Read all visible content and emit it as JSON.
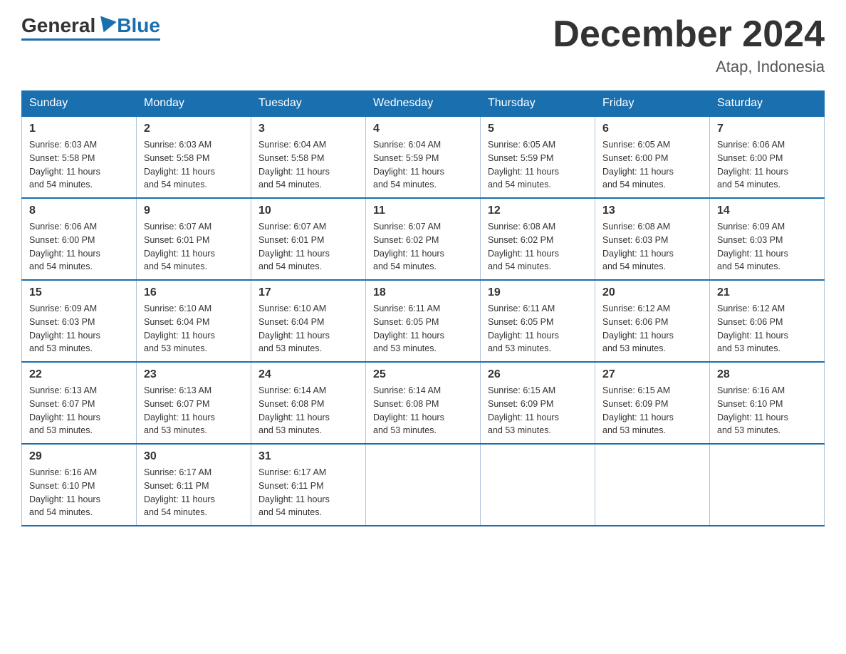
{
  "header": {
    "logo": {
      "text_general": "General",
      "text_blue": "Blue"
    },
    "title": "December 2024",
    "location": "Atap, Indonesia"
  },
  "calendar": {
    "days_of_week": [
      "Sunday",
      "Monday",
      "Tuesday",
      "Wednesday",
      "Thursday",
      "Friday",
      "Saturday"
    ],
    "weeks": [
      [
        {
          "day": "1",
          "sunrise": "6:03 AM",
          "sunset": "5:58 PM",
          "daylight": "11 hours and 54 minutes."
        },
        {
          "day": "2",
          "sunrise": "6:03 AM",
          "sunset": "5:58 PM",
          "daylight": "11 hours and 54 minutes."
        },
        {
          "day": "3",
          "sunrise": "6:04 AM",
          "sunset": "5:58 PM",
          "daylight": "11 hours and 54 minutes."
        },
        {
          "day": "4",
          "sunrise": "6:04 AM",
          "sunset": "5:59 PM",
          "daylight": "11 hours and 54 minutes."
        },
        {
          "day": "5",
          "sunrise": "6:05 AM",
          "sunset": "5:59 PM",
          "daylight": "11 hours and 54 minutes."
        },
        {
          "day": "6",
          "sunrise": "6:05 AM",
          "sunset": "6:00 PM",
          "daylight": "11 hours and 54 minutes."
        },
        {
          "day": "7",
          "sunrise": "6:06 AM",
          "sunset": "6:00 PM",
          "daylight": "11 hours and 54 minutes."
        }
      ],
      [
        {
          "day": "8",
          "sunrise": "6:06 AM",
          "sunset": "6:00 PM",
          "daylight": "11 hours and 54 minutes."
        },
        {
          "day": "9",
          "sunrise": "6:07 AM",
          "sunset": "6:01 PM",
          "daylight": "11 hours and 54 minutes."
        },
        {
          "day": "10",
          "sunrise": "6:07 AM",
          "sunset": "6:01 PM",
          "daylight": "11 hours and 54 minutes."
        },
        {
          "day": "11",
          "sunrise": "6:07 AM",
          "sunset": "6:02 PM",
          "daylight": "11 hours and 54 minutes."
        },
        {
          "day": "12",
          "sunrise": "6:08 AM",
          "sunset": "6:02 PM",
          "daylight": "11 hours and 54 minutes."
        },
        {
          "day": "13",
          "sunrise": "6:08 AM",
          "sunset": "6:03 PM",
          "daylight": "11 hours and 54 minutes."
        },
        {
          "day": "14",
          "sunrise": "6:09 AM",
          "sunset": "6:03 PM",
          "daylight": "11 hours and 54 minutes."
        }
      ],
      [
        {
          "day": "15",
          "sunrise": "6:09 AM",
          "sunset": "6:03 PM",
          "daylight": "11 hours and 53 minutes."
        },
        {
          "day": "16",
          "sunrise": "6:10 AM",
          "sunset": "6:04 PM",
          "daylight": "11 hours and 53 minutes."
        },
        {
          "day": "17",
          "sunrise": "6:10 AM",
          "sunset": "6:04 PM",
          "daylight": "11 hours and 53 minutes."
        },
        {
          "day": "18",
          "sunrise": "6:11 AM",
          "sunset": "6:05 PM",
          "daylight": "11 hours and 53 minutes."
        },
        {
          "day": "19",
          "sunrise": "6:11 AM",
          "sunset": "6:05 PM",
          "daylight": "11 hours and 53 minutes."
        },
        {
          "day": "20",
          "sunrise": "6:12 AM",
          "sunset": "6:06 PM",
          "daylight": "11 hours and 53 minutes."
        },
        {
          "day": "21",
          "sunrise": "6:12 AM",
          "sunset": "6:06 PM",
          "daylight": "11 hours and 53 minutes."
        }
      ],
      [
        {
          "day": "22",
          "sunrise": "6:13 AM",
          "sunset": "6:07 PM",
          "daylight": "11 hours and 53 minutes."
        },
        {
          "day": "23",
          "sunrise": "6:13 AM",
          "sunset": "6:07 PM",
          "daylight": "11 hours and 53 minutes."
        },
        {
          "day": "24",
          "sunrise": "6:14 AM",
          "sunset": "6:08 PM",
          "daylight": "11 hours and 53 minutes."
        },
        {
          "day": "25",
          "sunrise": "6:14 AM",
          "sunset": "6:08 PM",
          "daylight": "11 hours and 53 minutes."
        },
        {
          "day": "26",
          "sunrise": "6:15 AM",
          "sunset": "6:09 PM",
          "daylight": "11 hours and 53 minutes."
        },
        {
          "day": "27",
          "sunrise": "6:15 AM",
          "sunset": "6:09 PM",
          "daylight": "11 hours and 53 minutes."
        },
        {
          "day": "28",
          "sunrise": "6:16 AM",
          "sunset": "6:10 PM",
          "daylight": "11 hours and 53 minutes."
        }
      ],
      [
        {
          "day": "29",
          "sunrise": "6:16 AM",
          "sunset": "6:10 PM",
          "daylight": "11 hours and 54 minutes."
        },
        {
          "day": "30",
          "sunrise": "6:17 AM",
          "sunset": "6:11 PM",
          "daylight": "11 hours and 54 minutes."
        },
        {
          "day": "31",
          "sunrise": "6:17 AM",
          "sunset": "6:11 PM",
          "daylight": "11 hours and 54 minutes."
        },
        null,
        null,
        null,
        null
      ]
    ],
    "labels": {
      "sunrise": "Sunrise:",
      "sunset": "Sunset:",
      "daylight": "Daylight:"
    }
  }
}
